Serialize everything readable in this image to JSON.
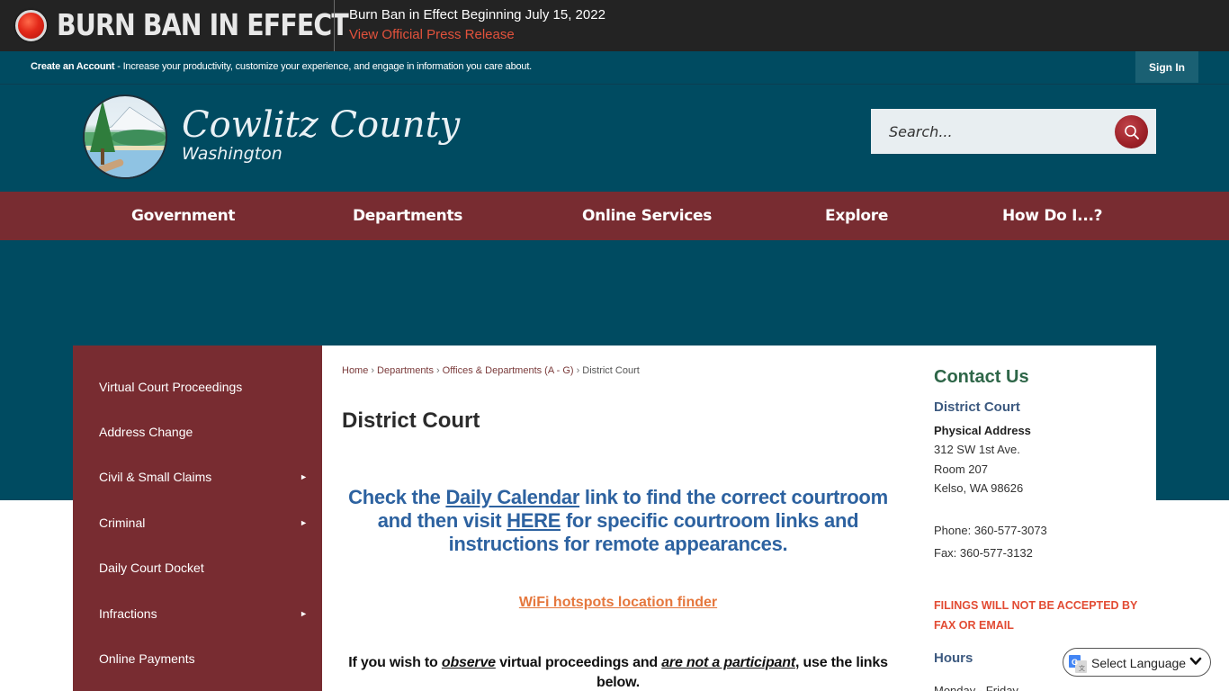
{
  "alert": {
    "title": "BURN BAN IN EFFECT",
    "message": "Burn Ban in Effect Beginning July 15, 2022",
    "link_label": "View Official Press Release"
  },
  "account_bar": {
    "create_account_label": "Create an Account",
    "tagline": " - Increase your productivity, customize your experience, and engage in information you care about.",
    "sign_in_label": "Sign In"
  },
  "header": {
    "site_title": "Cowlitz County",
    "site_subtitle": "Washington",
    "search_placeholder": "Search..."
  },
  "main_nav": [
    {
      "label": "Government"
    },
    {
      "label": "Departments"
    },
    {
      "label": "Online Services"
    },
    {
      "label": "Explore"
    },
    {
      "label": "How Do I...?"
    }
  ],
  "sidebar": {
    "items": [
      {
        "label": "Virtual Court Proceedings",
        "has_submenu": false
      },
      {
        "label": "Address Change",
        "has_submenu": false
      },
      {
        "label": "Civil & Small Claims",
        "has_submenu": true
      },
      {
        "label": "Criminal",
        "has_submenu": true
      },
      {
        "label": "Daily Court Docket",
        "has_submenu": false
      },
      {
        "label": "Infractions",
        "has_submenu": true
      },
      {
        "label": "Online Payments",
        "has_submenu": false
      }
    ],
    "submenu_glyph": "►"
  },
  "breadcrumb": [
    {
      "label": "Home"
    },
    {
      "label": "Departments"
    },
    {
      "label": "Offices & Departments (A - G)"
    },
    {
      "label": "District Court"
    }
  ],
  "breadcrumb_separator": "›",
  "page": {
    "title": "District Court",
    "notice": {
      "part1": "Check the ",
      "link1": "Daily Calendar",
      "part2": " link to find the correct courtroom and then visit ",
      "link2": "HERE",
      "part3": " for specific courtroom links and instructions for remote appearances."
    },
    "wifi_link": "WiFi hotspots location finder",
    "observe": {
      "part1": "If you wish to ",
      "em1": "observe",
      "part2": " virtual proceedings and ",
      "em2": "are not a participant",
      "part3": ", use the links below."
    }
  },
  "contact": {
    "title": "Contact Us",
    "department": "District Court",
    "address_label": "Physical Address",
    "address_lines": [
      "312 SW 1st Ave.",
      "Room 207",
      "Kelso, WA 98626"
    ],
    "phone": "Phone: 360-577-3073",
    "fax": "Fax: 360-577-3132",
    "warning": "FILINGS WILL NOT BE ACCEPTED BY FAX OR EMAIL",
    "hours_label": "Hours",
    "hours_days": "Monday - Friday"
  },
  "translate": {
    "label": "Select Language"
  },
  "colors": {
    "alert_bg": "#232323",
    "alert_link": "#e2523c",
    "teal": "#004b61",
    "maroon": "#782c31",
    "notice_blue": "#2d62a0",
    "wifi_orange": "#e5773d",
    "contact_green": "#2e6648",
    "warning_red": "#e24b33"
  }
}
